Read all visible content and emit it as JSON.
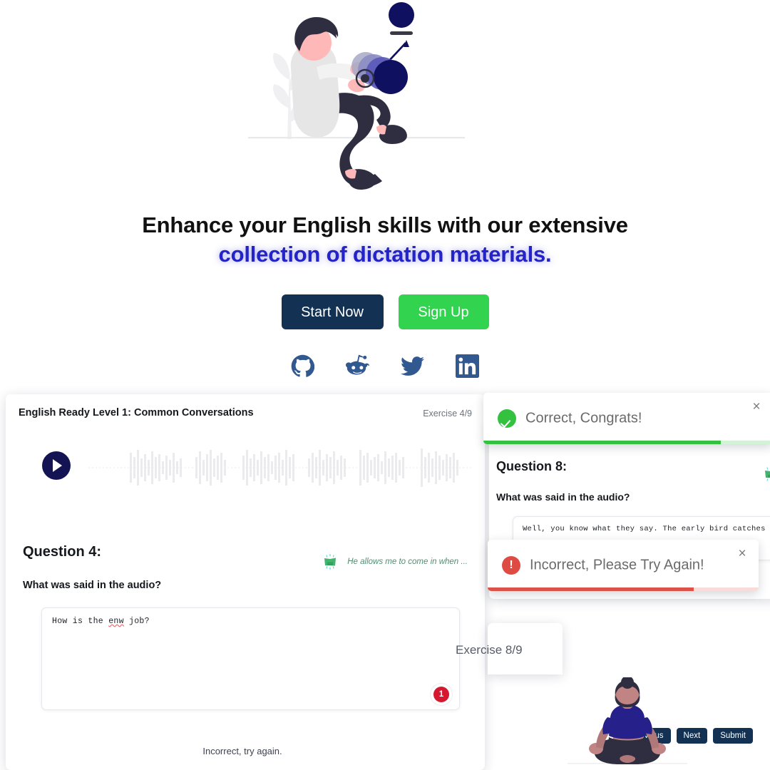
{
  "hero": {
    "illustration_name": "man-with-megaphone-illustration",
    "headline_line1": "Enhance your English skills with our extensive",
    "headline_line2": "collection of dictation materials.",
    "headline_accent_color": "#2323c8",
    "buttons": {
      "start_label": "Start Now",
      "start_color": "#133253",
      "signup_label": "Sign Up",
      "signup_color": "#32d44f"
    },
    "socials": [
      {
        "name": "github-icon",
        "label": "GitHub"
      },
      {
        "name": "reddit-icon",
        "label": "Reddit"
      },
      {
        "name": "twitter-icon",
        "label": "Twitter"
      },
      {
        "name": "linkedin-icon",
        "label": "LinkedIn"
      }
    ],
    "social_color": "#31598f"
  },
  "panel_left": {
    "title": "English Ready Level 1: Common Conversations",
    "exercise_count": "Exercise 4/9",
    "player": {
      "play_icon": "play-icon",
      "play_color": "#141455",
      "waveform_color": "#ebebee"
    },
    "question_title": "Question 4:",
    "question_prompt": "What was said in the audio?",
    "hint": {
      "icon": "hint-bulb-icon",
      "text": "He allows me to come in when ...",
      "color": "#4e8f72"
    },
    "answer": {
      "text_before": "How is the ",
      "text_typo": "enw",
      "text_after": " job?",
      "error_badge": "1",
      "error_badge_color": "#d5182f"
    },
    "nav_buttons": [
      {
        "label": "Previous",
        "name": "previous-button"
      },
      {
        "label": "Next",
        "name": "next-button"
      },
      {
        "label": "Submit",
        "name": "submit-button"
      }
    ],
    "status_message": "Incorrect, try again."
  },
  "panel_right": {
    "question_title": "Question 8:",
    "question_prompt": "What was said in the audio?",
    "answer_text": "Well, you know what they say. The early bird catches the worm.",
    "hint_icon": "hint-bulb-icon"
  },
  "panel_exercise_clipped": {
    "exercise_count": "Exercise 8/9"
  },
  "toast_correct": {
    "message": "Correct, Congrats!",
    "icon": "check-circle-icon",
    "close_icon": "close-icon",
    "close_label": "×",
    "color": "#34c13f",
    "progress_percent": 82
  },
  "toast_incorrect": {
    "message": "Incorrect, Please Try Again!",
    "icon": "error-circle-icon",
    "close_icon": "close-icon",
    "close_label": "×",
    "color": "#dd4b42",
    "progress_percent": 76
  },
  "yoga": {
    "illustration_name": "person-meditating-illustration"
  }
}
